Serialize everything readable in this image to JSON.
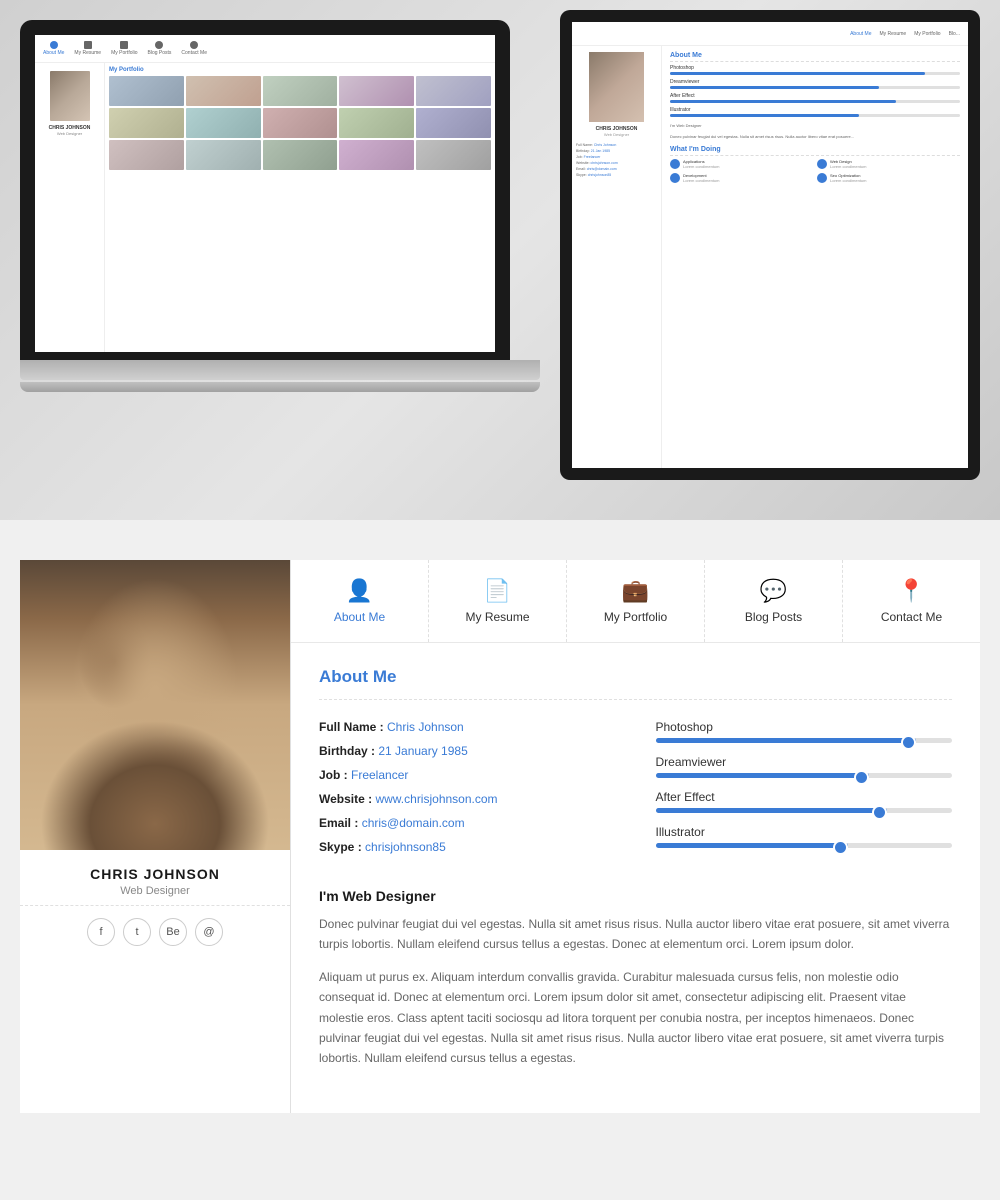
{
  "top": {
    "laptop_screen": "Portfolio",
    "tablet_screen": "About Me"
  },
  "nav": {
    "tabs": [
      {
        "id": "about",
        "icon": "👤",
        "label": "About Me",
        "active": true
      },
      {
        "id": "resume",
        "icon": "📄",
        "label": "My Resume",
        "active": false
      },
      {
        "id": "portfolio",
        "icon": "💼",
        "label": "My Portfolio",
        "active": false
      },
      {
        "id": "blog",
        "icon": "💬",
        "label": "Blog Posts",
        "active": false
      },
      {
        "id": "contact",
        "icon": "📍",
        "label": "Contact Me",
        "active": false
      }
    ]
  },
  "profile": {
    "name": "CHRIS JOHNSON",
    "job": "Web Designer",
    "social": [
      "f",
      "t",
      "Be",
      "@"
    ]
  },
  "about": {
    "section_title": "About Me",
    "info": [
      {
        "label": "Full Name :",
        "value": "Chris Johnson"
      },
      {
        "label": "Birthday :",
        "value": "21 January 1985"
      },
      {
        "label": "Job :",
        "value": "Freelancer"
      },
      {
        "label": "Website :",
        "value": "www.chrisjohnson.com"
      },
      {
        "label": "Email :",
        "value": "chris@domain.com"
      },
      {
        "label": "Skype :",
        "value": "chrisjohnson85"
      }
    ],
    "skills": [
      {
        "name": "Photoshop",
        "pct": 88
      },
      {
        "name": "Dreamviewer",
        "pct": 72
      },
      {
        "name": "After Effect",
        "pct": 78
      },
      {
        "name": "Illustrator",
        "pct": 65
      }
    ],
    "bio_title": "I'm Web Designer",
    "bio_p1": "Donec pulvinar feugiat dui vel egestas. Nulla sit amet risus risus. Nulla auctor libero vitae erat posuere, sit amet viverra turpis lobortis. Nullam eleifend cursus tellus a egestas. Donec at elementum orci. Lorem ipsum dolor.",
    "bio_p2": "Aliquam ut purus ex. Aliquam interdum convallis gravida. Curabitur malesuada cursus felis, non molestie odio consequat id. Donec at elementum orci. Lorem ipsum dolor sit amet, consectetur adipiscing elit. Praesent vitae molestie eros. Class aptent taciti sociosqu ad litora torquent per conubia nostra, per inceptos himenaeos. Donec pulvinar feugiat dui vel egestas. Nulla sit amet risus risus. Nulla auctor libero vitae erat posuere, sit amet viverra turpis lobortis. Nullam eleifend cursus tellus a egestas."
  }
}
